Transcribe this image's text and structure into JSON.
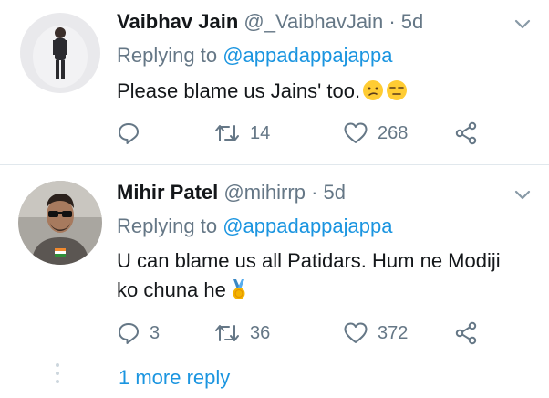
{
  "tweets": [
    {
      "name": "Vaibhav Jain",
      "handle": "@_VaibhavJain",
      "dot": "·",
      "time": "5d",
      "replying_prefix": "Replying to",
      "replying_to": "@appadappajappa",
      "text": "Please blame us Jains' too.",
      "emojis": [
        "confused-face-emoji",
        "unamused-face-emoji"
      ],
      "replies": "",
      "retweets": "14",
      "likes": "268"
    },
    {
      "name": "Mihir Patel",
      "handle": "@mihirrp",
      "dot": "·",
      "time": "5d",
      "replying_prefix": "Replying to",
      "replying_to": "@appadappajappa",
      "text": "U can blame us all Patidars. Hum ne Modiji ko chuna he",
      "emojis": [
        "medal-emoji"
      ],
      "replies": "3",
      "retweets": "36",
      "likes": "372"
    }
  ],
  "more_replies": "1 more reply",
  "colors": {
    "accent": "#1b95e0",
    "secondary_text": "#657786",
    "divider": "#e1e8ed"
  }
}
